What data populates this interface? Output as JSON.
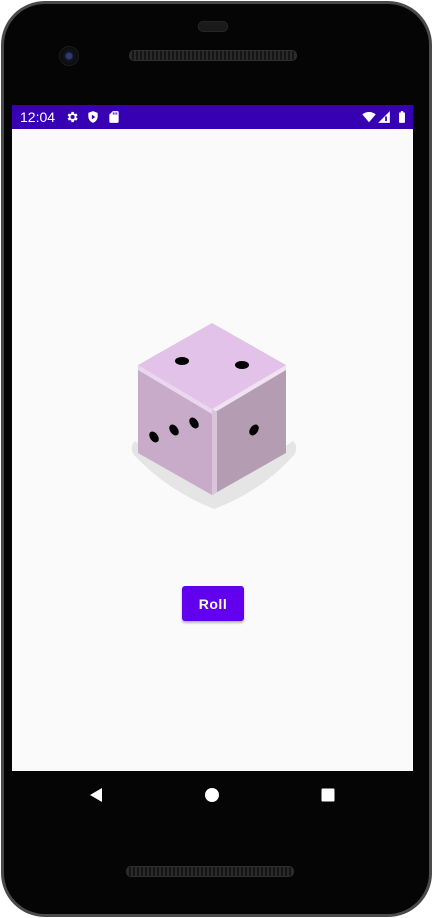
{
  "status_bar": {
    "time": "12:04",
    "color": "#3700b3",
    "left_icons": [
      "gear-icon",
      "shield-icon",
      "sd-card-icon"
    ],
    "right_icons": [
      "wifi-icon",
      "cell-signal-icon",
      "battery-icon"
    ]
  },
  "main": {
    "dice_image": {
      "icon": "dice-icon",
      "top_face_pips": 2,
      "left_face_pips": 3,
      "right_face_pips": 1
    },
    "roll_button": {
      "label": "Roll",
      "color": "#6200ee"
    }
  },
  "navigation_bar": {
    "buttons": [
      "back-icon",
      "home-icon",
      "recents-icon"
    ]
  }
}
